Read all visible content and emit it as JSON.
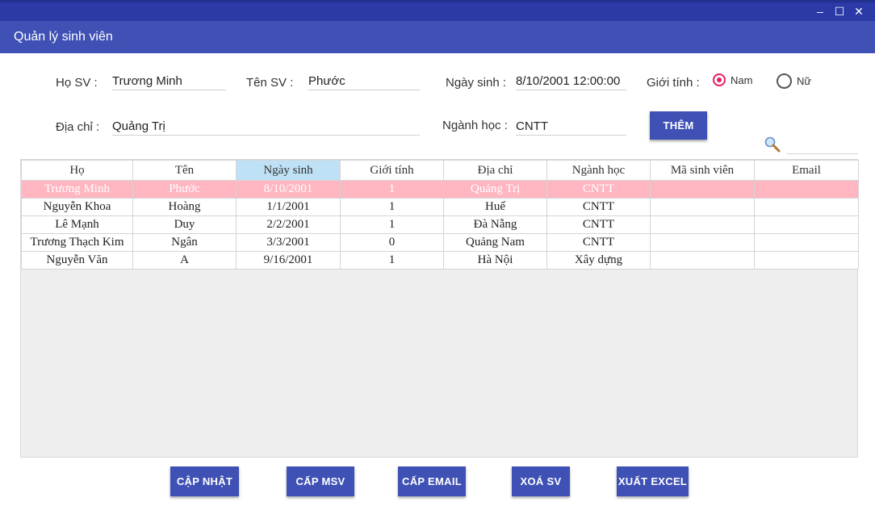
{
  "window": {
    "minimize_icon": "minimize-icon",
    "maximize_icon": "maximize-icon",
    "close_icon": "close-icon",
    "min_glyph": "–",
    "max_glyph": "☐",
    "close_glyph": "✕"
  },
  "appbar": {
    "title": "Quản lý sinh viên"
  },
  "form": {
    "ho_label": "Họ SV :",
    "ho_value": "Trương Minh",
    "ten_label": "Tên SV :",
    "ten_value": "Phước",
    "ngaysinh_label": "Ngày sinh :",
    "ngaysinh_value": "8/10/2001 12:00:00",
    "gioitinh_label": "Giới tính :",
    "radio_nam": "Nam",
    "radio_nu": "Nữ",
    "selected_gender": "Nam",
    "diachi_label": "Địa chỉ :",
    "diachi_value": "Quảng Trị",
    "nganh_label": "Ngành học :",
    "nganh_value": "CNTT",
    "add_button": "THÊM"
  },
  "search": {
    "icon": "search-icon",
    "value": ""
  },
  "table": {
    "columns": [
      "Họ",
      "Tên",
      "Ngày sinh",
      "Giới tính",
      "Địa chỉ",
      "Ngành học",
      "Mã sinh viên",
      "Email"
    ],
    "sorted_column": "Ngày sinh",
    "rows": [
      [
        "Trương Minh",
        "Phước",
        "8/10/2001",
        "1",
        "Quảng Trị",
        "CNTT",
        "",
        ""
      ],
      [
        "Nguyễn Khoa",
        "Hoàng",
        "1/1/2001",
        "1",
        "Huế",
        "CNTT",
        "",
        ""
      ],
      [
        "Lê Mạnh",
        "Duy",
        "2/2/2001",
        "1",
        "Đà Nẵng",
        "CNTT",
        "",
        ""
      ],
      [
        "Trương Thạch Kim",
        "Ngân",
        "3/3/2001",
        "0",
        "Quảng Nam",
        "CNTT",
        "",
        ""
      ],
      [
        "Nguyễn Văn",
        "A",
        "9/16/2001",
        "1",
        "Hà Nội",
        "Xây dựng",
        "",
        ""
      ]
    ],
    "selected_row": "Trương Minh Phước"
  },
  "actions": {
    "update": "CẬP NHẬT",
    "msv": "CẤP MSV",
    "email": "CẤP EMAIL",
    "delete": "XOÁ SV",
    "export": "XUẤT EXCEL"
  },
  "colors": {
    "primary": "#3f51b5",
    "title_bar": "#2b3aa6",
    "accent_radio": "#e91e63",
    "selected_row": "#ffb6c1",
    "sorted_header": "#bfe1f6"
  }
}
